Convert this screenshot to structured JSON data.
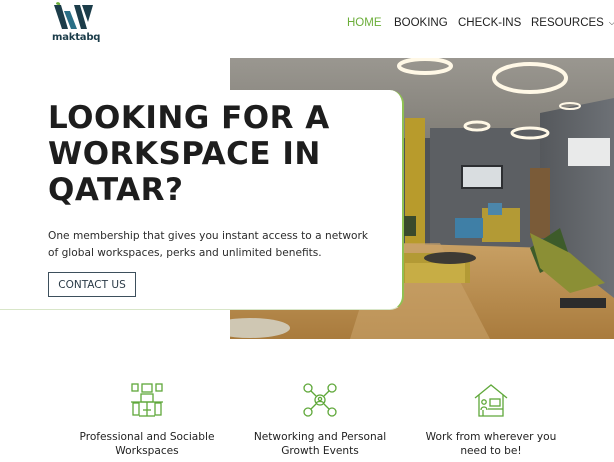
{
  "brand": {
    "name": "maktabq",
    "accent": "#6cae3a",
    "dark": "#1c3d4a"
  },
  "nav": {
    "items": [
      {
        "label": "HOME",
        "active": true
      },
      {
        "label": "BOOKING",
        "active": false
      },
      {
        "label": "CHECK-INS",
        "active": false
      },
      {
        "label": "RESOURCES",
        "active": false,
        "icon": "chevron-down-icon"
      }
    ]
  },
  "hero": {
    "title": "LOOKING FOR A WORKSPACE IN QATAR?",
    "subtitle": "One membership that gives you instant access to a network of global workspaces, perks and unlimited benefits.",
    "cta_label": "CONTACT US"
  },
  "features": [
    {
      "icon": "workspace-desk-icon",
      "label": "Professional and Sociable\nWorkspaces"
    },
    {
      "icon": "network-people-icon",
      "label": "Networking and Personal\nGrowth Events"
    },
    {
      "icon": "home-office-icon",
      "label": "Work from wherever you\nneed to be!"
    }
  ]
}
